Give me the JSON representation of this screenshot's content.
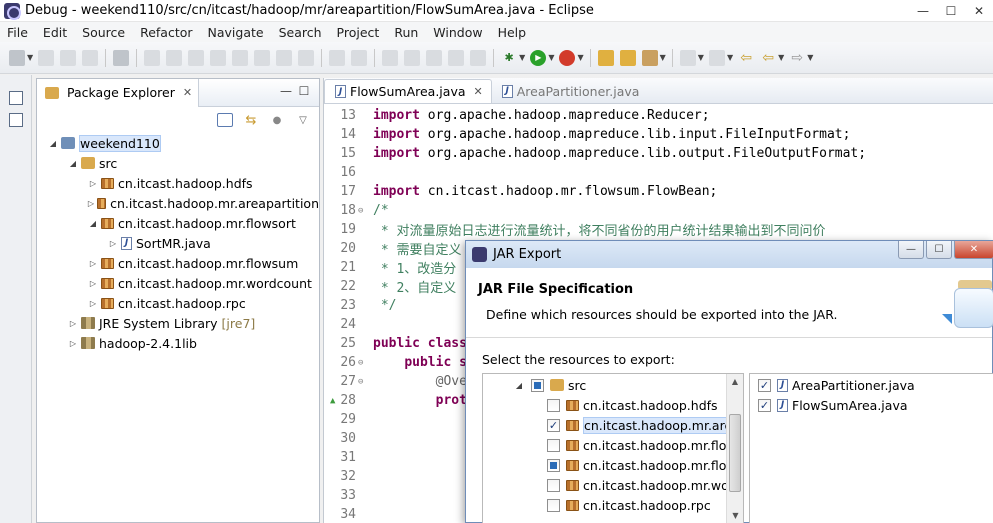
{
  "window": {
    "title": "Debug - weekend110/src/cn/itcast/hadoop/mr/areapartition/FlowSumArea.java - Eclipse"
  },
  "menu": [
    "File",
    "Edit",
    "Source",
    "Refactor",
    "Navigate",
    "Search",
    "Project",
    "Run",
    "Window",
    "Help"
  ],
  "package_explorer": {
    "tab_label": "Package Explorer",
    "tree": [
      {
        "label": "weekend110",
        "level": 0,
        "twisty": "▲",
        "icon": "project",
        "selected": true
      },
      {
        "label": "src",
        "level": 1,
        "twisty": "▲",
        "icon": "source-folder"
      },
      {
        "label": "cn.itcast.hadoop.hdfs",
        "level": 2,
        "twisty": "▷",
        "icon": "package"
      },
      {
        "label": "cn.itcast.hadoop.mr.areapartition",
        "level": 2,
        "twisty": "▷",
        "icon": "package"
      },
      {
        "label": "cn.itcast.hadoop.mr.flowsort",
        "level": 2,
        "twisty": "▲",
        "icon": "package"
      },
      {
        "label": "SortMR.java",
        "level": 3,
        "twisty": "▷",
        "icon": "java-file"
      },
      {
        "label": "cn.itcast.hadoop.mr.flowsum",
        "level": 2,
        "twisty": "▷",
        "icon": "package"
      },
      {
        "label": "cn.itcast.hadoop.mr.wordcount",
        "level": 2,
        "twisty": "▷",
        "icon": "package"
      },
      {
        "label": "cn.itcast.hadoop.rpc",
        "level": 2,
        "twisty": "▷",
        "icon": "package"
      },
      {
        "label": "JRE System Library",
        "decoration": "[jre7]",
        "level": 1,
        "twisty": "▷",
        "icon": "library"
      },
      {
        "label": "hadoop-2.4.1lib",
        "level": 1,
        "twisty": "▷",
        "icon": "library"
      }
    ]
  },
  "editor": {
    "tabs": [
      {
        "label": "FlowSumArea.java",
        "active": true
      },
      {
        "label": "AreaPartitioner.java",
        "active": false
      }
    ],
    "lines": [
      {
        "num": "13",
        "fold": "",
        "parts": [
          {
            "t": "kw",
            "v": "import"
          },
          {
            "t": "n",
            "v": " org.apache.hadoop.mapreduce.Reducer;"
          }
        ]
      },
      {
        "num": "14",
        "fold": "",
        "parts": [
          {
            "t": "kw",
            "v": "import"
          },
          {
            "t": "n",
            "v": " org.apache.hadoop.mapreduce.lib.input.FileInputFormat;"
          }
        ]
      },
      {
        "num": "15",
        "fold": "",
        "parts": [
          {
            "t": "kw",
            "v": "import"
          },
          {
            "t": "n",
            "v": " org.apache.hadoop.mapreduce.lib.output.FileOutputFormat;"
          }
        ]
      },
      {
        "num": "16",
        "fold": "",
        "parts": []
      },
      {
        "num": "17",
        "fold": "",
        "parts": [
          {
            "t": "kw",
            "v": "import"
          },
          {
            "t": "n",
            "v": " cn.itcast.hadoop.mr.flowsum.FlowBean;"
          }
        ]
      },
      {
        "num": "18",
        "fold": "⊖",
        "parts": [
          {
            "t": "cm",
            "v": "/*"
          }
        ]
      },
      {
        "num": "19",
        "fold": "",
        "parts": [
          {
            "t": "cm",
            "v": " * 对流量原始日志进行流量统计，将不同省份的用户统计结果输出到不同问价"
          }
        ]
      },
      {
        "num": "20",
        "fold": "",
        "parts": [
          {
            "t": "cm",
            "v": " * 需要自定义"
          }
        ]
      },
      {
        "num": "21",
        "fold": "",
        "parts": [
          {
            "t": "cm",
            "v": " * 1、改造分"
          }
        ]
      },
      {
        "num": "22",
        "fold": "",
        "parts": [
          {
            "t": "cm",
            "v": " * 2、自定义"
          }
        ]
      },
      {
        "num": "23",
        "fold": "",
        "parts": [
          {
            "t": "cm",
            "v": " */"
          }
        ]
      },
      {
        "num": "24",
        "fold": "",
        "parts": []
      },
      {
        "num": "25",
        "fold": "",
        "parts": [
          {
            "t": "kw",
            "v": "public class"
          }
        ]
      },
      {
        "num": "26",
        "fold": "⊖",
        "parts": [
          {
            "t": "n",
            "v": "    "
          },
          {
            "t": "kw",
            "v": "public s"
          }
        ]
      },
      {
        "num": "27",
        "fold": "⊖",
        "parts": [
          {
            "t": "n",
            "v": "        "
          },
          {
            "t": "an",
            "v": "@Ove"
          }
        ]
      },
      {
        "num": "28",
        "fold": "",
        "marker": "▲",
        "parts": [
          {
            "t": "n",
            "v": "        "
          },
          {
            "t": "kw",
            "v": "prot"
          }
        ]
      },
      {
        "num": "29",
        "fold": "",
        "parts": []
      },
      {
        "num": "30",
        "fold": "",
        "parts": []
      },
      {
        "num": "31",
        "fold": "",
        "parts": []
      },
      {
        "num": "32",
        "fold": "",
        "parts": []
      },
      {
        "num": "33",
        "fold": "",
        "parts": []
      },
      {
        "num": "34",
        "fold": "",
        "parts": []
      }
    ]
  },
  "dialog": {
    "title": "JAR Export",
    "header_title": "JAR File Specification",
    "header_desc": "Define which resources should be exported into the JAR.",
    "select_label": "Select the resources to export:",
    "left_tree": [
      {
        "label": "src",
        "level": 0,
        "twisty": "▲",
        "check": "partial",
        "icon": "source-folder"
      },
      {
        "label": "cn.itcast.hadoop.hdfs",
        "level": 1,
        "check": "none",
        "icon": "package"
      },
      {
        "label": "cn.itcast.hadoop.mr.area",
        "level": 1,
        "check": "checked",
        "icon": "package",
        "selected": true
      },
      {
        "label": "cn.itcast.hadoop.mr.flow",
        "level": 1,
        "check": "none",
        "icon": "package"
      },
      {
        "label": "cn.itcast.hadoop.mr.flow",
        "level": 1,
        "check": "partial",
        "icon": "package"
      },
      {
        "label": "cn.itcast.hadoop.mr.wor",
        "level": 1,
        "check": "none",
        "icon": "package"
      },
      {
        "label": "cn.itcast.hadoop.rpc",
        "level": 1,
        "check": "none",
        "icon": "package"
      }
    ],
    "right_list": [
      {
        "label": "AreaPartitioner.java",
        "check": "checked"
      },
      {
        "label": "FlowSumArea.java",
        "check": "checked"
      }
    ]
  }
}
